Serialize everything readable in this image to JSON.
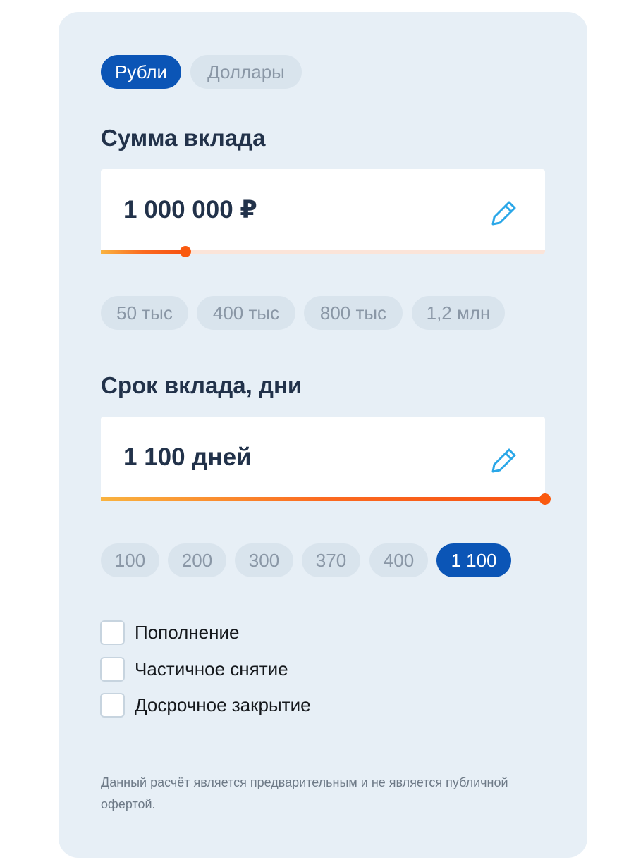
{
  "currency_tabs": [
    {
      "label": "Рубли",
      "active": true
    },
    {
      "label": "Доллары",
      "active": false
    }
  ],
  "amount": {
    "title": "Сумма вклада",
    "value": "1 000 000 ₽",
    "slider_fraction": 0.19,
    "presets": [
      "50 тыс",
      "400 тыс",
      "800 тыс",
      "1,2 млн"
    ]
  },
  "term": {
    "title": "Срок вклада, дни",
    "value": "1 100 дней",
    "slider_fraction": 1.0,
    "presets": [
      "100",
      "200",
      "300",
      "370",
      "400",
      "1 100"
    ],
    "selected_preset": "1 100"
  },
  "options": [
    {
      "label": "Пополнение",
      "checked": false
    },
    {
      "label": "Частичное снятие",
      "checked": false
    },
    {
      "label": "Досрочное закрытие",
      "checked": false
    }
  ],
  "disclaimer": "Данный расчёт является предварительным и не является публичной офертой.",
  "icons": {
    "edit": "pencil-icon"
  },
  "colors": {
    "accent": "#0b55b6",
    "slider": "#fa5a0f",
    "edit_icon": "#2aa7e8",
    "card_bg": "#e7eff6"
  }
}
